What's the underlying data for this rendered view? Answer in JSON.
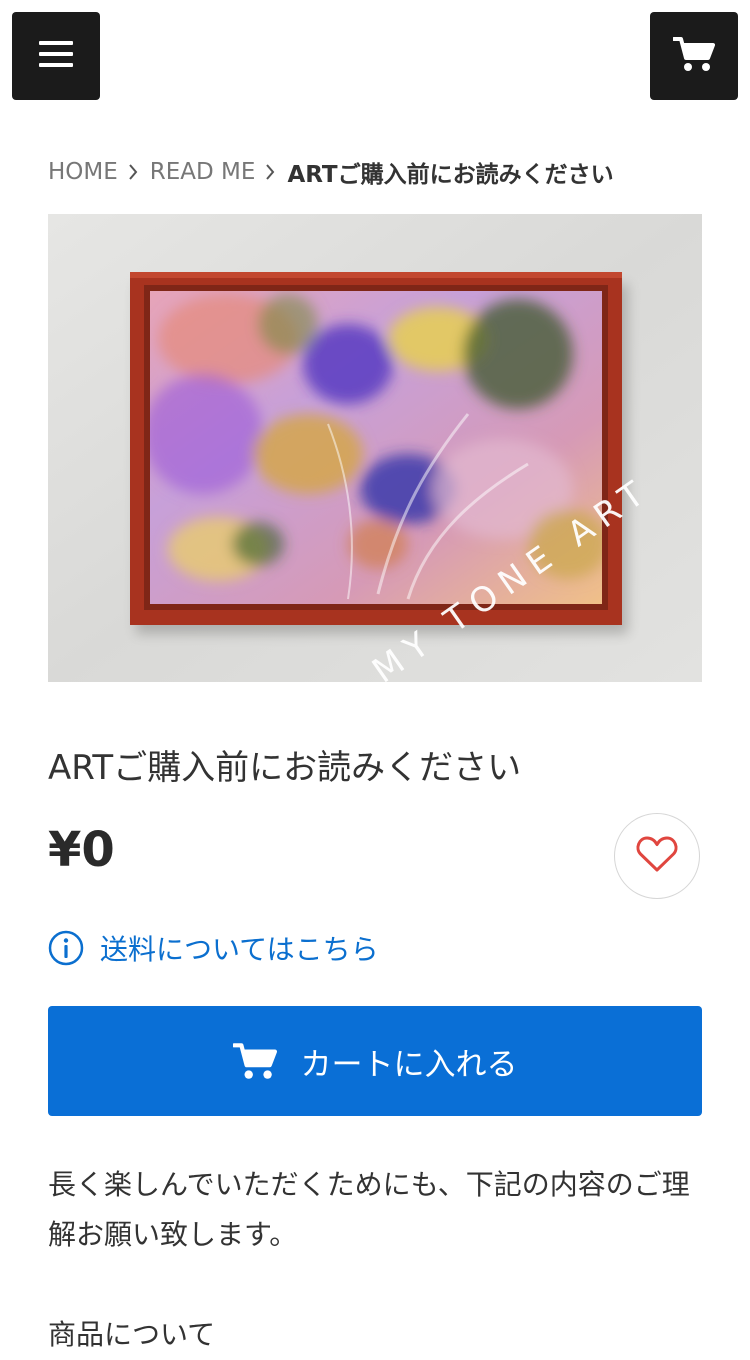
{
  "header": {
    "menu_icon": "hamburger-icon",
    "cart_icon": "cart-icon"
  },
  "breadcrumb": {
    "items": [
      "HOME",
      "READ ME"
    ],
    "current": "ARTご購入前にお読みください"
  },
  "product": {
    "image_watermark": "MY TONE ART",
    "title": "ARTご購入前にお読みください",
    "price": "¥0",
    "favorite_icon": "heart-icon",
    "shipping_link": "送料についてはこちら",
    "shipping_icon": "info-icon",
    "add_to_cart": "カートに入れる",
    "description": "長く楽しんでいただくためにも、下記の内容のご理解お願い致します。",
    "section_heading": "商品について"
  },
  "colors": {
    "header_button_bg": "#1b1b1b",
    "link": "#0b6fcf",
    "primary_button": "#0a6fd6",
    "heart": "#e0463f",
    "frame": "#a8331f"
  }
}
